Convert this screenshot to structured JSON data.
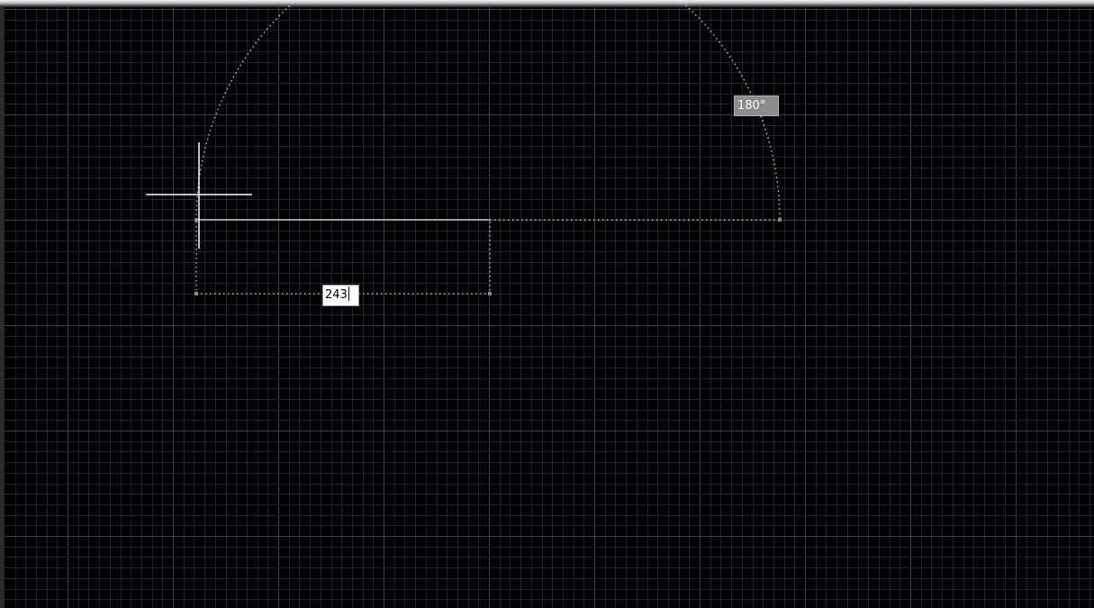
{
  "viewport": {
    "background": "#000000",
    "grid_minor_color": "#1f2033",
    "grid_major_color": "#3c3e52"
  },
  "dimension_input": {
    "value": "243"
  },
  "angle_tooltip": {
    "text": "180°"
  },
  "cursor": {
    "type": "crosshair"
  }
}
